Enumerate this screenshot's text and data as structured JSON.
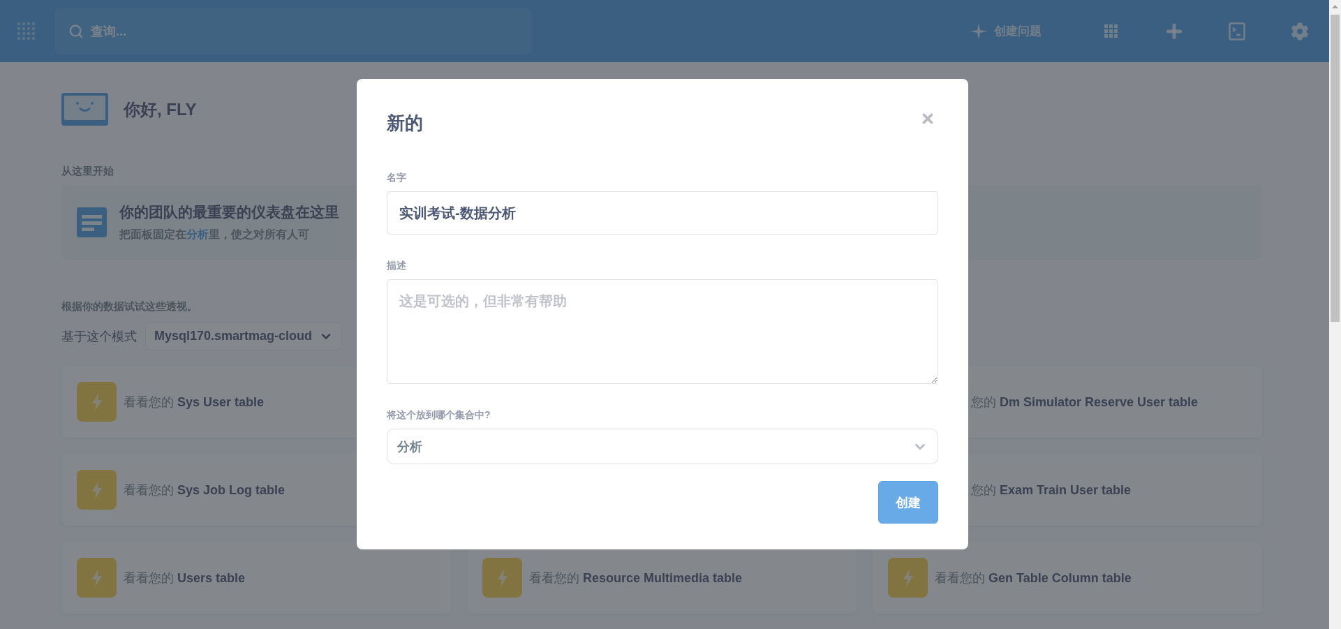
{
  "topbar": {
    "search": {
      "placeholder": "查询..."
    },
    "new_question": "创建问题"
  },
  "greeting": "你好, FLY",
  "start_here": {
    "heading": "从这里开始",
    "card_title": "你的团队的最重要的仪表盘在这里",
    "card_text_before": "把面板固定在",
    "card_link": "分析",
    "card_text_after": "里，使之对所有人可"
  },
  "suggestions": {
    "heading": "根据你的数据试试这些透视。",
    "schema_label": "基于这个模式",
    "schema_value": "Mysql170.smartmag-cloud",
    "rows": [
      {
        "left": {
          "kind": "full",
          "text": "看看您的 **Sys User table**"
        },
        "right": {
          "kind": "cut",
          "text": "您的 **Dm Simulator Reserve User table**"
        }
      },
      {
        "left": {
          "kind": "full",
          "text": "看看您的 **Sys Job Log table**"
        },
        "right": {
          "kind": "cut",
          "text": "您的 **Exam Train User table**"
        }
      },
      {
        "left": {
          "kind": "full",
          "text": "看看您的 **Users table**"
        },
        "middle": {
          "kind": "full",
          "text": "看看您的 **Resource Multimedia table**"
        },
        "right": {
          "kind": "full",
          "text": "看看您的 **Gen Table Column table**"
        }
      }
    ]
  },
  "modal": {
    "title": "新的",
    "fields": [
      {
        "kind": "input",
        "label": "名字",
        "value": "实训考试-数据分析"
      },
      {
        "kind": "textarea",
        "label": "描述",
        "placeholder": "这是可选的，但非常有帮助"
      },
      {
        "kind": "select",
        "label": "将这个放到哪个集合中?",
        "value": "分析"
      }
    ],
    "submit": "创建"
  }
}
